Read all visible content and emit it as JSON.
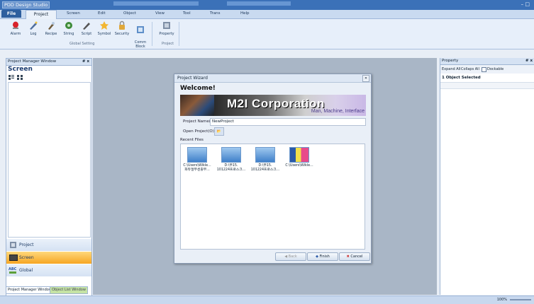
{
  "app": {
    "title": "PDD Design Studio"
  },
  "window_buttons": "– □",
  "tabs": [
    {
      "label": "File"
    },
    {
      "label": "Project"
    },
    {
      "label": "Screen"
    },
    {
      "label": "Edit"
    },
    {
      "label": "Object"
    },
    {
      "label": "View"
    },
    {
      "label": "Tool"
    },
    {
      "label": "Trans"
    },
    {
      "label": "Help"
    }
  ],
  "ribbon": {
    "buttons": [
      {
        "label": "Alarm"
      },
      {
        "label": "Log"
      },
      {
        "label": "Recipe"
      },
      {
        "label": "String"
      },
      {
        "label": "Script"
      },
      {
        "label": "Symbol"
      },
      {
        "label": "Security"
      },
      {
        "label": "Comm\nBlock"
      },
      {
        "label": "Property"
      }
    ],
    "group_global": "Global Setting",
    "group_project": "Project"
  },
  "left_panel": {
    "header": "Project Manager Window",
    "pin": "# x",
    "section_title": "Screen",
    "nav": [
      {
        "label": "Project"
      },
      {
        "label": "Screen"
      },
      {
        "label": "Global"
      }
    ],
    "bottom_tabs": [
      "Project Manager Window",
      "Object List Window"
    ]
  },
  "dialog": {
    "title": "Project Wizard",
    "close": "✕",
    "welcome": "Welcome!",
    "banner_title": "M2I Corporation",
    "banner_sub": "Man, Machine, Interface",
    "project_name_label": "Project Name(P) :",
    "project_name_value": "NewProject",
    "open_project_label": "Open Project(O) :",
    "open_btn": "📂",
    "recent_files_label": "Recent Files",
    "recent_files": [
      {
        "name": "C:\\Users\\Wikle...\n화듀얼부센출부..."
      },
      {
        "name": "D:\\부15.\n101224프로스크..."
      },
      {
        "name": "D:\\부15.\n101224프로스크..."
      },
      {
        "name": "C:\\Users\\Wikle..."
      }
    ],
    "buttons": {
      "back": "Back",
      "finish": "Finish",
      "cancel": "Cancel"
    }
  },
  "right_panel": {
    "header": "Property",
    "pin": "# x",
    "expand_all": "Expand All",
    "collapse_all": "Collaps All",
    "dockable": "Dockable",
    "selected_text": "1 Object Selected"
  },
  "status": {
    "zoom": "100%"
  }
}
